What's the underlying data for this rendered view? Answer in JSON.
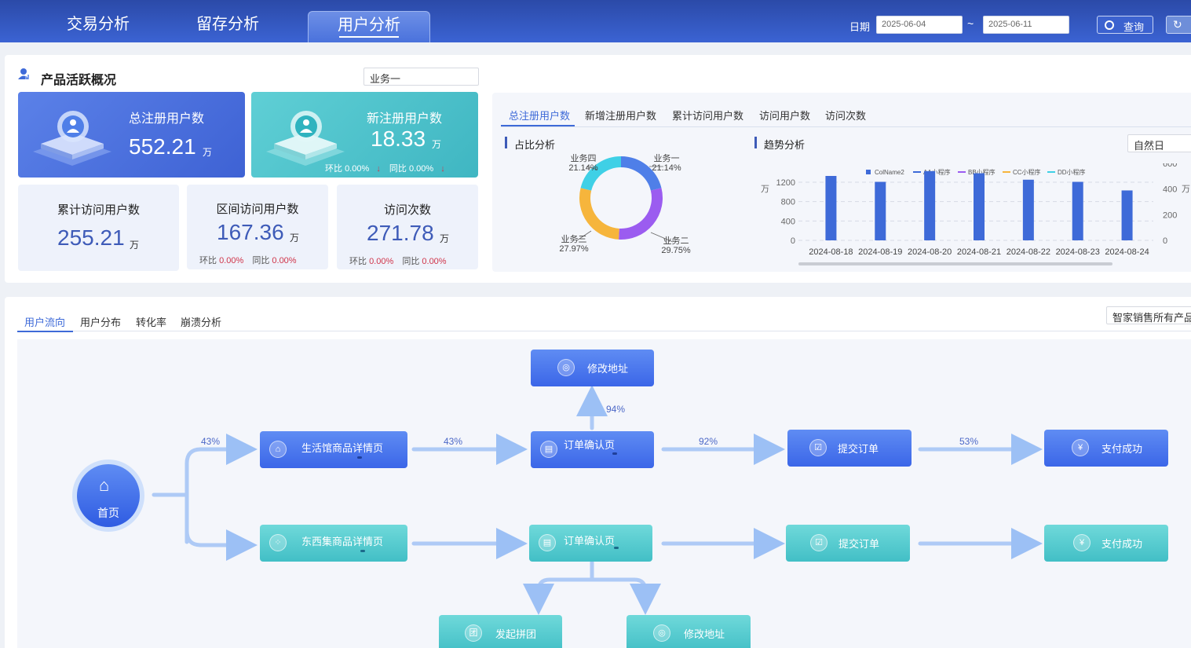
{
  "header": {
    "tabs": [
      {
        "label": "交易分析"
      },
      {
        "label": "留存分析"
      },
      {
        "label": "用户分析"
      }
    ],
    "date_label": "日期",
    "date_start": "2025-06-04",
    "date_sep": "~",
    "date_end": "2025-06-11",
    "query_label": "查询",
    "refresh_glyph": "↻"
  },
  "overview": {
    "title": "产品活跃概况",
    "business_select": "业务一",
    "total_registered": {
      "title": "总注册用户数",
      "value": "552.21",
      "unit": "万"
    },
    "new_registered": {
      "title": "新注册用户数",
      "value": "18.33",
      "unit": "万",
      "hb_label": "环比",
      "hb_value": "0.00%",
      "tb_label": "同比",
      "tb_value": "0.00%"
    },
    "cumulative_visitors": {
      "title": "累计访问用户数",
      "value": "255.21",
      "unit": "万"
    },
    "interval_visitors": {
      "title": "区间访问用户数",
      "value": "167.36",
      "unit": "万",
      "hb_label": "环比",
      "hb_value": "0.00%",
      "tb_label": "同比",
      "tb_value": "0.00%"
    },
    "visits": {
      "title": "访问次数",
      "value": "271.78",
      "unit": "万",
      "hb_label": "环比",
      "hb_value": "0.00%",
      "tb_label": "同比",
      "tb_value": "0.00%"
    }
  },
  "chart_panel": {
    "tabs": [
      {
        "label": "总注册用户数"
      },
      {
        "label": "新增注册用户数"
      },
      {
        "label": "累计访问用户数"
      },
      {
        "label": "访问用户数"
      },
      {
        "label": "访问次数"
      }
    ],
    "pie_title": "占比分析",
    "trend_title": "趋势分析",
    "granularity": "自然日"
  },
  "chart_data": [
    {
      "type": "pie",
      "title": "占比分析",
      "donut": true,
      "slices": [
        {
          "name": "业务一",
          "label": "21.14%",
          "value": 21.14,
          "color": "#4f7fe8"
        },
        {
          "name": "业务二",
          "label": "29.75%",
          "value": 29.75,
          "color": "#9b5cf0"
        },
        {
          "name": "业务三",
          "label": "27.97%",
          "value": 27.97,
          "color": "#f6b53c"
        },
        {
          "name": "业务四",
          "label": "21.14%",
          "value": 21.14,
          "color": "#3fd0e6"
        }
      ]
    },
    {
      "type": "bar",
      "title": "趋势分析",
      "legend": [
        {
          "name": "ColName2",
          "color": "#3e6ad8"
        },
        {
          "name": "AA小程序",
          "color": "#3e6ad8"
        },
        {
          "name": "BB小程序",
          "color": "#9b5cf0"
        },
        {
          "name": "CC小程序",
          "color": "#f6b53c"
        },
        {
          "name": "DD小程序",
          "color": "#3fd0e6"
        }
      ],
      "categories": [
        "2024-08-18",
        "2024-08-19",
        "2024-08-20",
        "2024-08-21",
        "2024-08-22",
        "2024-08-23",
        "2024-08-24"
      ],
      "series": [
        {
          "name": "ColName2",
          "values": [
            1200,
            1090,
            1290,
            1250,
            1130,
            1090,
            930
          ]
        }
      ],
      "ylabel": "万",
      "ylim": [
        0,
        1200
      ],
      "yticks": [
        "0",
        "400",
        "800",
        "1200"
      ],
      "y2label": "万",
      "y2ticks": [
        "0",
        "200",
        "400",
        "600"
      ],
      "grid": true,
      "legend_position": "top"
    }
  ],
  "flow": {
    "tabs": [
      {
        "label": "用户流向"
      },
      {
        "label": "用户分布"
      },
      {
        "label": "转化率"
      },
      {
        "label": "崩溃分析"
      }
    ],
    "product_select": "智家销售所有产品",
    "home_label": "首页",
    "nodes": {
      "modify_address_top": "修改地址",
      "life_detail": "生活馆商品详情页",
      "order_confirm_blue": "订单确认页",
      "submit_blue": "提交订单",
      "pay_blue": "支付成功",
      "dongxi_detail": "东西集商品详情页",
      "order_confirm_teal": "订单确认页",
      "submit_teal": "提交订单",
      "pay_teal": "支付成功",
      "group_buy": "发起拼团",
      "modify_address_bottom": "修改地址"
    },
    "percents": {
      "home_to_life": "43%",
      "life_to_order": "43%",
      "order_to_address": "94%",
      "order_to_submit": "92%",
      "submit_to_pay": "53%"
    }
  }
}
